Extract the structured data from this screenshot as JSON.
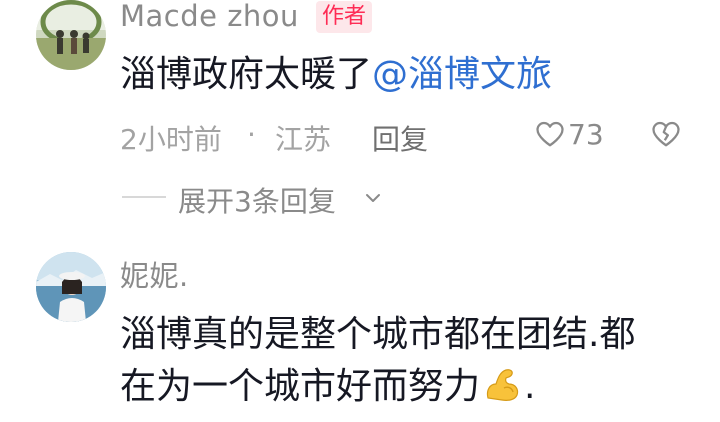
{
  "comments": [
    {
      "username": "Macde zhou",
      "badge": "作者",
      "text": "淄博政府太暖了",
      "mention": "@淄博文旅",
      "time": "2小时前",
      "separator": "·",
      "location": "江苏",
      "reply_label": "回复",
      "likes": "73",
      "expand_label": "展开3条回复"
    },
    {
      "username": "妮妮.",
      "text_line1": "淄博真的是整个城市都在团结.都",
      "text_line2": "在为一个城市好而努力",
      "emoji": "💪",
      "text_end": "."
    }
  ],
  "icons": {
    "like": "heart-outline-icon",
    "dislike": "broken-heart-icon",
    "expand": "chevron-down-icon",
    "flex": "flexed-biceps-emoji"
  },
  "colors": {
    "badge_bg": "#fde7ea",
    "badge_text": "#fe2c55",
    "mention": "#2f6fd1",
    "text": "#161823",
    "muted": "#8a8a8a"
  }
}
